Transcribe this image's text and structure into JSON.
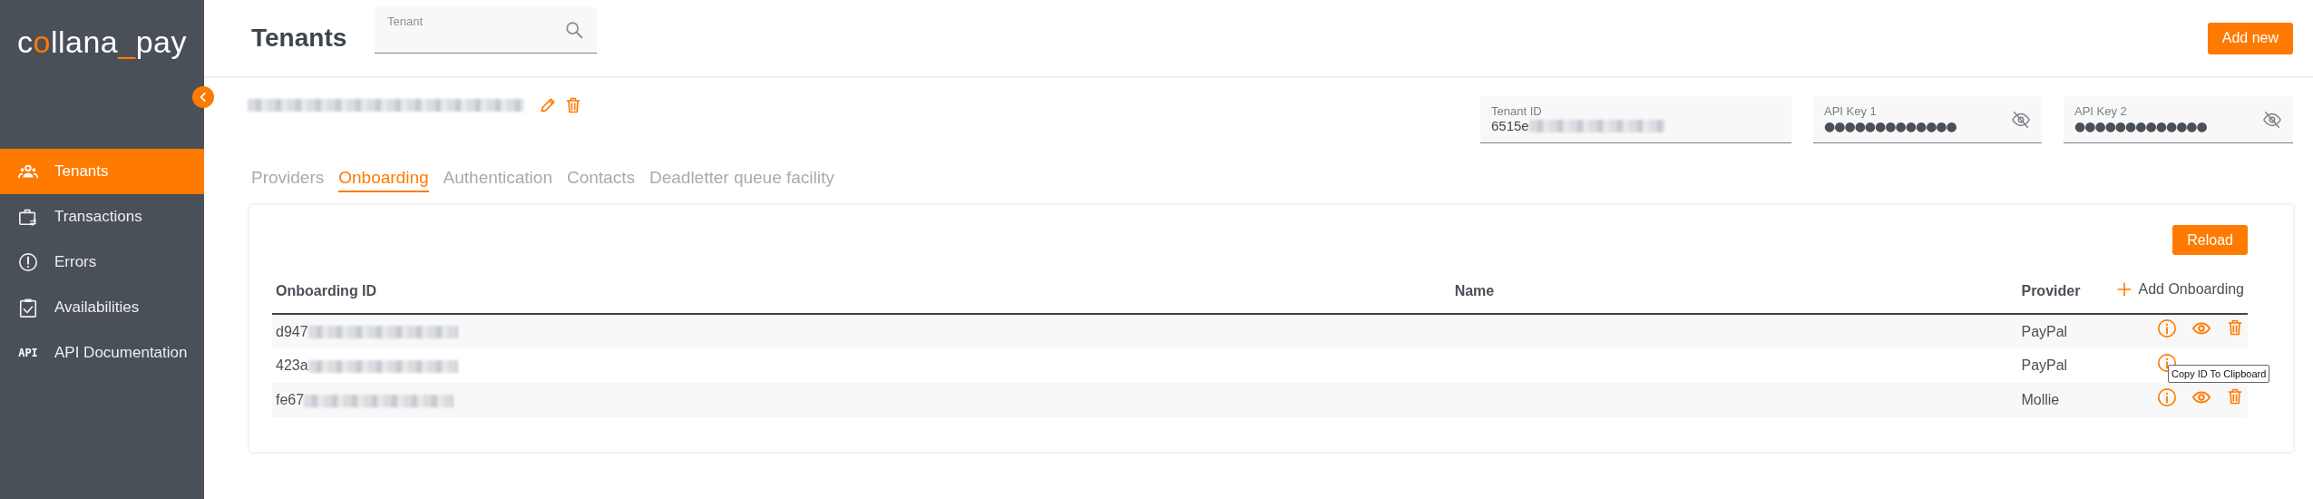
{
  "logo": [
    {
      "text": "c",
      "accent": false
    },
    {
      "text": "o",
      "accent": true
    },
    {
      "text": "llana",
      "accent": false
    },
    {
      "text": "_",
      "accent": true
    },
    {
      "text": "pay",
      "accent": false
    }
  ],
  "sidebar": {
    "items": [
      {
        "label": "Tenants",
        "selected": true
      },
      {
        "label": "Transactions",
        "selected": false
      },
      {
        "label": "Errors",
        "selected": false
      },
      {
        "label": "Availabilities",
        "selected": false
      },
      {
        "label": "API Documentation",
        "selected": false,
        "icon_text": "API"
      }
    ]
  },
  "header": {
    "title": "Tenants",
    "search": {
      "placeholder": "Tenant"
    },
    "add_button": "Add new"
  },
  "tenant": {
    "fields": [
      {
        "label": "Tenant ID",
        "value": "6515e",
        "kind": "text"
      },
      {
        "label": "API Key 1",
        "value": "●●●●●●●●●●●●●",
        "kind": "secret"
      },
      {
        "label": "API Key 2",
        "value": "●●●●●●●●●●●●●",
        "kind": "secret"
      }
    ]
  },
  "tabs": [
    {
      "label": "Providers",
      "selected": false
    },
    {
      "label": "Onboarding",
      "selected": true
    },
    {
      "label": "Authentication",
      "selected": false
    },
    {
      "label": "Contacts",
      "selected": false
    },
    {
      "label": "Deadletter queue facility",
      "selected": false
    }
  ],
  "onboarding": {
    "reload_button": "Reload",
    "columns": [
      "Onboarding ID",
      "Name",
      "Provider"
    ],
    "add_label": "Add Onboarding",
    "rows": [
      {
        "id": "d947",
        "provider": "PayPal"
      },
      {
        "id": "423a",
        "provider": "PayPal",
        "tooltip": "Copy ID To Clipboard"
      },
      {
        "id": "fe67",
        "provider": "Mollie"
      }
    ]
  }
}
